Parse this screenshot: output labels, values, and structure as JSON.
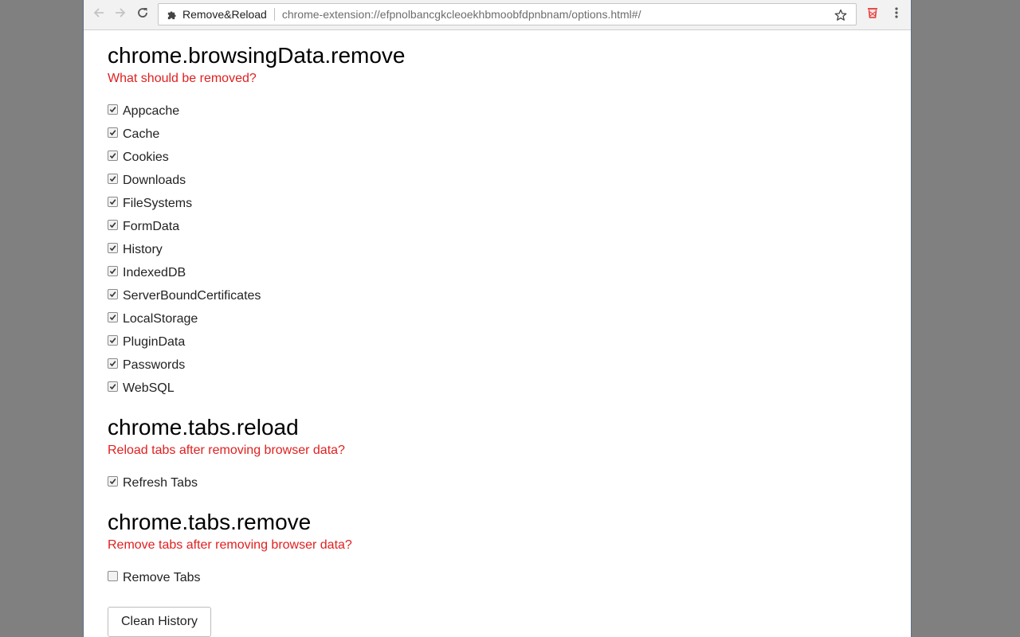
{
  "browser": {
    "ext_name": "Remove&Reload",
    "url": "chrome-extension://efpnolbancgkcleoekhbmoobfdpnbnam/options.html#/",
    "icons": {
      "back": "arrow-left-icon",
      "forward": "arrow-right-icon",
      "reload": "reload-icon",
      "extension": "puzzle-piece-icon",
      "bookmark": "star-icon",
      "extension_action": "trash-bin-icon",
      "menu": "kebab-menu-icon"
    },
    "accent_extension_color": "#e53935"
  },
  "sections": {
    "browsing_data": {
      "title": "chrome.browsingData.remove",
      "subtitle": "What should be removed?",
      "options": [
        {
          "label": "Appcache",
          "checked": true
        },
        {
          "label": "Cache",
          "checked": true
        },
        {
          "label": "Cookies",
          "checked": true
        },
        {
          "label": "Downloads",
          "checked": true
        },
        {
          "label": "FileSystems",
          "checked": true
        },
        {
          "label": "FormData",
          "checked": true
        },
        {
          "label": "History",
          "checked": true
        },
        {
          "label": "IndexedDB",
          "checked": true
        },
        {
          "label": "ServerBoundCertificates",
          "checked": true
        },
        {
          "label": "LocalStorage",
          "checked": true
        },
        {
          "label": "PluginData",
          "checked": true
        },
        {
          "label": "Passwords",
          "checked": true
        },
        {
          "label": "WebSQL",
          "checked": true
        }
      ]
    },
    "tabs_reload": {
      "title": "chrome.tabs.reload",
      "subtitle": "Reload tabs after removing browser data?",
      "option": {
        "label": "Refresh Tabs",
        "checked": true
      }
    },
    "tabs_remove": {
      "title": "chrome.tabs.remove",
      "subtitle": "Remove tabs after removing browser data?",
      "option": {
        "label": "Remove Tabs",
        "checked": false
      }
    }
  },
  "actions": {
    "clean_label": "Clean History"
  },
  "colors": {
    "subtitle": "#e02020",
    "page_background": "#808080"
  }
}
